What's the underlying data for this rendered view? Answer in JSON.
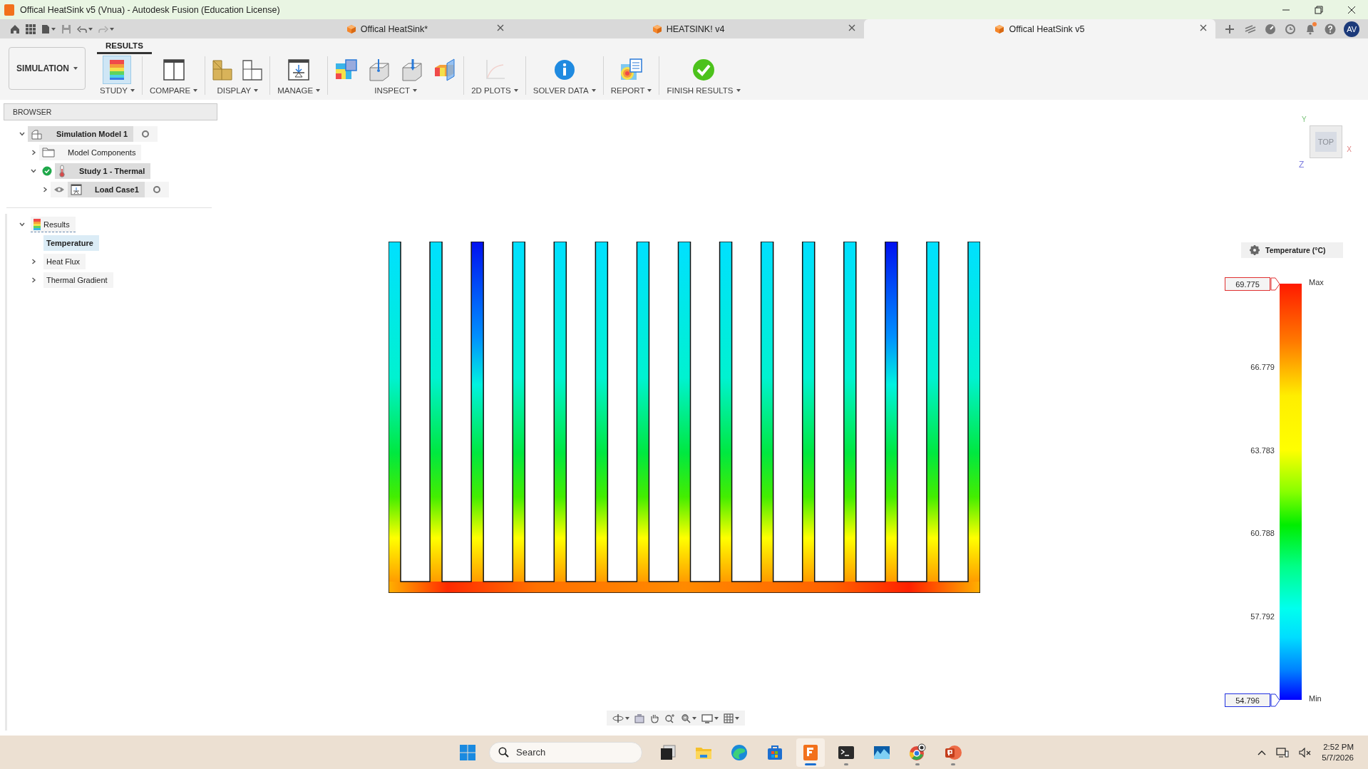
{
  "window": {
    "title": "Offical HeatSink v5 (Vnua) - Autodesk Fusion (Education License)"
  },
  "doc_tabs": [
    {
      "label": "Offical HeatSink*",
      "selected": false
    },
    {
      "label": "HEATSINK! v4",
      "selected": false
    },
    {
      "label": "Offical HeatSink v5",
      "selected": true
    }
  ],
  "account": {
    "initials": "AV",
    "notification": true
  },
  "workspace": {
    "label": "SIMULATION"
  },
  "toolbar_tabs": [
    {
      "label": "RESULTS",
      "selected": true
    }
  ],
  "toolbar_groups": [
    {
      "label": "STUDY",
      "tools": [
        {
          "kind": "study",
          "selected": true,
          "disabled": false
        }
      ]
    },
    {
      "label": "COMPARE",
      "tools": [
        {
          "kind": "compare",
          "selected": false,
          "disabled": false
        }
      ]
    },
    {
      "label": "DISPLAY",
      "tools": [
        {
          "kind": "shaded",
          "selected": false,
          "disabled": false
        },
        {
          "kind": "wireframe",
          "selected": false,
          "disabled": false
        }
      ]
    },
    {
      "label": "MANAGE",
      "tools": [
        {
          "kind": "manage",
          "selected": false,
          "disabled": false
        }
      ]
    },
    {
      "label": "INSPECT",
      "tools": [
        {
          "kind": "probe",
          "selected": false,
          "disabled": false
        },
        {
          "kind": "point-probe",
          "selected": false,
          "disabled": false
        },
        {
          "kind": "surface-probe",
          "selected": false,
          "disabled": false
        },
        {
          "kind": "slice",
          "selected": false,
          "disabled": false
        }
      ]
    },
    {
      "label": "2D PLOTS",
      "tools": [
        {
          "kind": "plot",
          "selected": false,
          "disabled": true
        }
      ]
    },
    {
      "label": "SOLVER DATA",
      "tools": [
        {
          "kind": "info",
          "selected": false,
          "disabled": false
        }
      ]
    },
    {
      "label": "REPORT",
      "tools": [
        {
          "kind": "report",
          "selected": false,
          "disabled": false
        }
      ]
    },
    {
      "label": "FINISH RESULTS",
      "tools": [
        {
          "kind": "finish",
          "selected": false,
          "disabled": false
        }
      ]
    }
  ],
  "browser": {
    "title": "BROWSER",
    "tree": [
      {
        "label": "Simulation Model 1",
        "kind": "model",
        "expanded": true,
        "highlighted": true,
        "radio": true,
        "children": [
          {
            "label": "Model Components",
            "kind": "folder",
            "expanded": false,
            "highlighted": false,
            "radio": false
          },
          {
            "label": "Study 1 - Thermal",
            "kind": "study",
            "expanded": true,
            "highlighted": true,
            "radio": false,
            "solved": true,
            "children": [
              {
                "label": "Load Case1",
                "kind": "load-case",
                "expanded": false,
                "highlighted": true,
                "radio": true,
                "visible": true
              }
            ]
          }
        ]
      }
    ],
    "results": {
      "label": "Results",
      "expanded": true,
      "children": [
        {
          "label": "Temperature",
          "selected": true
        },
        {
          "label": "Heat Flux",
          "selected": false,
          "expanded": false
        },
        {
          "label": "Thermal Gradient",
          "selected": false,
          "expanded": false
        }
      ]
    }
  },
  "view_cube": {
    "face": "TOP",
    "axes": {
      "y": "Y",
      "x": "X",
      "z": "Z"
    }
  },
  "legend": {
    "title": "Temperature (°C)",
    "max": "69.775",
    "max_label": "Max",
    "ticks": [
      "66.779",
      "63.783",
      "60.788",
      "57.792"
    ],
    "min": "54.796",
    "min_label": "Min"
  },
  "taskbar": {
    "search": {
      "placeholder": "Search"
    },
    "apps": [
      {
        "kind": "task-view",
        "running": false,
        "active": false
      },
      {
        "kind": "explorer",
        "running": false,
        "active": false
      },
      {
        "kind": "edge",
        "running": false,
        "active": false
      },
      {
        "kind": "store",
        "running": false,
        "active": false
      },
      {
        "kind": "fusion",
        "running": true,
        "active": true
      },
      {
        "kind": "terminal",
        "running": true,
        "active": false
      },
      {
        "kind": "photos",
        "running": false,
        "active": false
      },
      {
        "kind": "chrome",
        "running": true,
        "active": false
      },
      {
        "kind": "powerpoint",
        "running": true,
        "active": false
      }
    ],
    "time": "2:52 PM",
    "date": "5/7/2026"
  }
}
